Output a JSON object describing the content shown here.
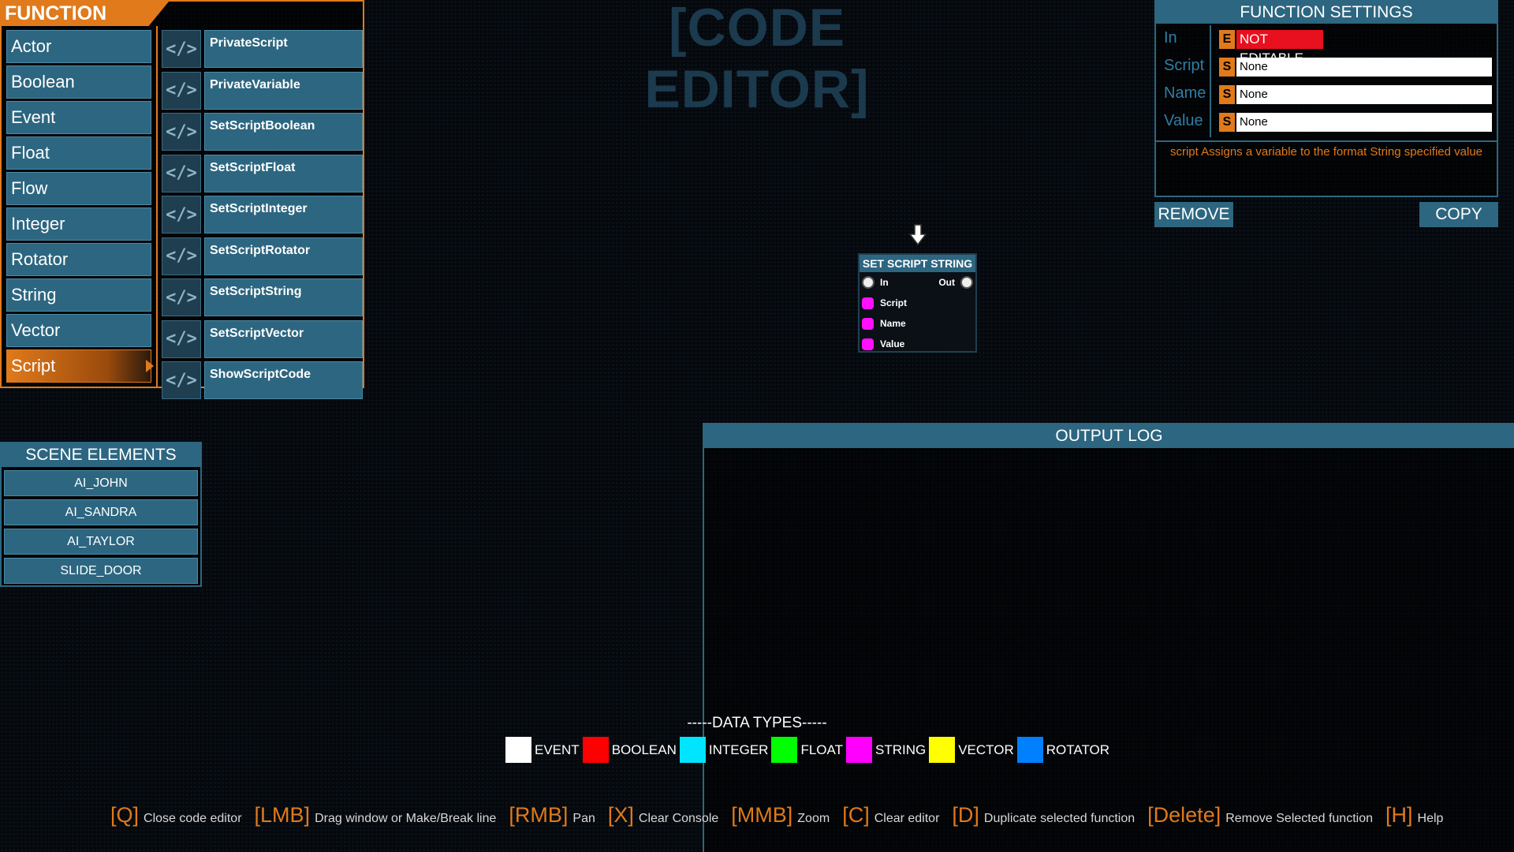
{
  "editor_title": "[CODE EDITOR]",
  "function_library": {
    "title": "FUNCTION LIBRARY",
    "categories": [
      {
        "label": "Actor"
      },
      {
        "label": "Boolean"
      },
      {
        "label": "Event"
      },
      {
        "label": "Float"
      },
      {
        "label": "Flow"
      },
      {
        "label": "Integer"
      },
      {
        "label": "Rotator"
      },
      {
        "label": "String"
      },
      {
        "label": "Vector"
      },
      {
        "label": "Script",
        "selected": true
      }
    ],
    "icon_text": "</>",
    "functions": [
      {
        "label": "PrivateScript"
      },
      {
        "label": "PrivateVariable"
      },
      {
        "label": "SetScriptBoolean"
      },
      {
        "label": "SetScriptFloat"
      },
      {
        "label": "SetScriptInteger"
      },
      {
        "label": "SetScriptRotator"
      },
      {
        "label": "SetScriptString"
      },
      {
        "label": "SetScriptVector"
      },
      {
        "label": "ShowScriptCode"
      }
    ]
  },
  "function_settings": {
    "title": "FUNCTION SETTINGS",
    "rows": [
      {
        "label": "In",
        "badge": "E",
        "value": "NOT EDITABLE"
      },
      {
        "label": "Script",
        "badge": "S",
        "value": "None"
      },
      {
        "label": "Name",
        "badge": "S",
        "value": "None"
      },
      {
        "label": "Value",
        "badge": "S",
        "value": "None"
      }
    ],
    "description": "script Assigns a variable to the format String specified value",
    "remove_label": "REMOVE",
    "copy_label": "COPY"
  },
  "node": {
    "title": "SET SCRIPT STRING",
    "in_label": "In",
    "out_label": "Out",
    "inputs": [
      "Script",
      "Name",
      "Value"
    ]
  },
  "scene_elements": {
    "title": "SCENE ELEMENTS",
    "items": [
      "AI_JOHN",
      "AI_SANDRA",
      "AI_TAYLOR",
      "SLIDE_DOOR"
    ]
  },
  "output_log": {
    "title": "OUTPUT LOG"
  },
  "data_types": {
    "title": "-----DATA TYPES-----",
    "items": [
      {
        "label": "EVENT",
        "color": "#ffffff"
      },
      {
        "label": "BOOLEAN",
        "color": "#ff0000"
      },
      {
        "label": "INTEGER",
        "color": "#00e5ff"
      },
      {
        "label": "FLOAT",
        "color": "#00ff00"
      },
      {
        "label": "STRING",
        "color": "#ff00ff"
      },
      {
        "label": "VECTOR",
        "color": "#ffff00"
      },
      {
        "label": "ROTATOR",
        "color": "#0080ff"
      }
    ]
  },
  "shortcuts": [
    {
      "key": "[Q]",
      "desc": "Close code editor"
    },
    {
      "key": "[LMB]",
      "desc": "Drag window or Make/Break line"
    },
    {
      "key": "[RMB]",
      "desc": "Pan"
    },
    {
      "key": "[X]",
      "desc": "Clear Console"
    },
    {
      "key": "[MMB]",
      "desc": "Zoom"
    },
    {
      "key": "[C]",
      "desc": "Clear editor"
    },
    {
      "key": "[D]",
      "desc": "Duplicate selected function"
    },
    {
      "key": "[Delete]",
      "desc": "Remove Selected function"
    },
    {
      "key": "[H]",
      "desc": "Help"
    }
  ],
  "colors": {
    "accent_orange": "#e07a1b",
    "panel_blue": "#2d6680",
    "title_dim": "#1b3a4e",
    "not_editable_red": "#e8101e"
  }
}
